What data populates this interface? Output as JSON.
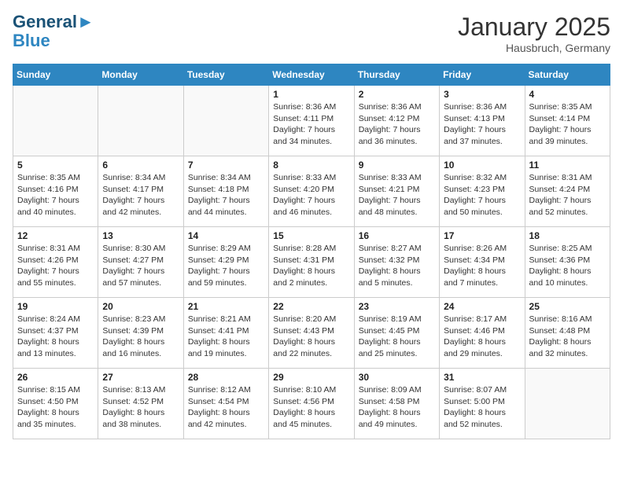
{
  "header": {
    "logo_line1": "General",
    "logo_line2": "Blue",
    "month": "January 2025",
    "location": "Hausbruch, Germany"
  },
  "weekdays": [
    "Sunday",
    "Monday",
    "Tuesday",
    "Wednesday",
    "Thursday",
    "Friday",
    "Saturday"
  ],
  "weeks": [
    [
      {
        "day": "",
        "info": ""
      },
      {
        "day": "",
        "info": ""
      },
      {
        "day": "",
        "info": ""
      },
      {
        "day": "1",
        "info": "Sunrise: 8:36 AM\nSunset: 4:11 PM\nDaylight: 7 hours\nand 34 minutes."
      },
      {
        "day": "2",
        "info": "Sunrise: 8:36 AM\nSunset: 4:12 PM\nDaylight: 7 hours\nand 36 minutes."
      },
      {
        "day": "3",
        "info": "Sunrise: 8:36 AM\nSunset: 4:13 PM\nDaylight: 7 hours\nand 37 minutes."
      },
      {
        "day": "4",
        "info": "Sunrise: 8:35 AM\nSunset: 4:14 PM\nDaylight: 7 hours\nand 39 minutes."
      }
    ],
    [
      {
        "day": "5",
        "info": "Sunrise: 8:35 AM\nSunset: 4:16 PM\nDaylight: 7 hours\nand 40 minutes."
      },
      {
        "day": "6",
        "info": "Sunrise: 8:34 AM\nSunset: 4:17 PM\nDaylight: 7 hours\nand 42 minutes."
      },
      {
        "day": "7",
        "info": "Sunrise: 8:34 AM\nSunset: 4:18 PM\nDaylight: 7 hours\nand 44 minutes."
      },
      {
        "day": "8",
        "info": "Sunrise: 8:33 AM\nSunset: 4:20 PM\nDaylight: 7 hours\nand 46 minutes."
      },
      {
        "day": "9",
        "info": "Sunrise: 8:33 AM\nSunset: 4:21 PM\nDaylight: 7 hours\nand 48 minutes."
      },
      {
        "day": "10",
        "info": "Sunrise: 8:32 AM\nSunset: 4:23 PM\nDaylight: 7 hours\nand 50 minutes."
      },
      {
        "day": "11",
        "info": "Sunrise: 8:31 AM\nSunset: 4:24 PM\nDaylight: 7 hours\nand 52 minutes."
      }
    ],
    [
      {
        "day": "12",
        "info": "Sunrise: 8:31 AM\nSunset: 4:26 PM\nDaylight: 7 hours\nand 55 minutes."
      },
      {
        "day": "13",
        "info": "Sunrise: 8:30 AM\nSunset: 4:27 PM\nDaylight: 7 hours\nand 57 minutes."
      },
      {
        "day": "14",
        "info": "Sunrise: 8:29 AM\nSunset: 4:29 PM\nDaylight: 7 hours\nand 59 minutes."
      },
      {
        "day": "15",
        "info": "Sunrise: 8:28 AM\nSunset: 4:31 PM\nDaylight: 8 hours\nand 2 minutes."
      },
      {
        "day": "16",
        "info": "Sunrise: 8:27 AM\nSunset: 4:32 PM\nDaylight: 8 hours\nand 5 minutes."
      },
      {
        "day": "17",
        "info": "Sunrise: 8:26 AM\nSunset: 4:34 PM\nDaylight: 8 hours\nand 7 minutes."
      },
      {
        "day": "18",
        "info": "Sunrise: 8:25 AM\nSunset: 4:36 PM\nDaylight: 8 hours\nand 10 minutes."
      }
    ],
    [
      {
        "day": "19",
        "info": "Sunrise: 8:24 AM\nSunset: 4:37 PM\nDaylight: 8 hours\nand 13 minutes."
      },
      {
        "day": "20",
        "info": "Sunrise: 8:23 AM\nSunset: 4:39 PM\nDaylight: 8 hours\nand 16 minutes."
      },
      {
        "day": "21",
        "info": "Sunrise: 8:21 AM\nSunset: 4:41 PM\nDaylight: 8 hours\nand 19 minutes."
      },
      {
        "day": "22",
        "info": "Sunrise: 8:20 AM\nSunset: 4:43 PM\nDaylight: 8 hours\nand 22 minutes."
      },
      {
        "day": "23",
        "info": "Sunrise: 8:19 AM\nSunset: 4:45 PM\nDaylight: 8 hours\nand 25 minutes."
      },
      {
        "day": "24",
        "info": "Sunrise: 8:17 AM\nSunset: 4:46 PM\nDaylight: 8 hours\nand 29 minutes."
      },
      {
        "day": "25",
        "info": "Sunrise: 8:16 AM\nSunset: 4:48 PM\nDaylight: 8 hours\nand 32 minutes."
      }
    ],
    [
      {
        "day": "26",
        "info": "Sunrise: 8:15 AM\nSunset: 4:50 PM\nDaylight: 8 hours\nand 35 minutes."
      },
      {
        "day": "27",
        "info": "Sunrise: 8:13 AM\nSunset: 4:52 PM\nDaylight: 8 hours\nand 38 minutes."
      },
      {
        "day": "28",
        "info": "Sunrise: 8:12 AM\nSunset: 4:54 PM\nDaylight: 8 hours\nand 42 minutes."
      },
      {
        "day": "29",
        "info": "Sunrise: 8:10 AM\nSunset: 4:56 PM\nDaylight: 8 hours\nand 45 minutes."
      },
      {
        "day": "30",
        "info": "Sunrise: 8:09 AM\nSunset: 4:58 PM\nDaylight: 8 hours\nand 49 minutes."
      },
      {
        "day": "31",
        "info": "Sunrise: 8:07 AM\nSunset: 5:00 PM\nDaylight: 8 hours\nand 52 minutes."
      },
      {
        "day": "",
        "info": ""
      }
    ]
  ]
}
